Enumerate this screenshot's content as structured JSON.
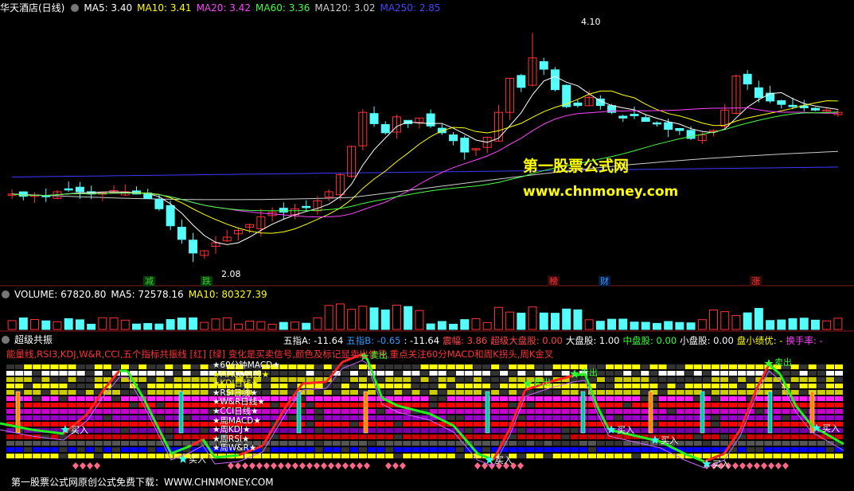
{
  "header": {
    "title": "华天酒店(日线)",
    "ma": [
      {
        "label": "MA5: 3.40",
        "color": "#ffffff"
      },
      {
        "label": "MA10: 3.41",
        "color": "#ffff00"
      },
      {
        "label": "MA20: 3.42",
        "color": "#ff44ff"
      },
      {
        "label": "MA60: 3.36",
        "color": "#44ff44"
      },
      {
        "label": "MA120: 3.02",
        "color": "#cccccc"
      },
      {
        "label": "MA250: 2.85",
        "color": "#4444ff"
      }
    ]
  },
  "price_panel": {
    "high_label": "4.10",
    "low_label": "2.08",
    "calendar_marks": [
      {
        "text": "减",
        "color": "#33cc33"
      },
      {
        "text": "跌",
        "color": "#33cc33"
      },
      {
        "text": "榜",
        "color": "#ff3333"
      },
      {
        "text": "财",
        "color": "#3399ff"
      },
      {
        "text": "涨",
        "color": "#ff3333"
      }
    ],
    "watermark_title": "第一股票公式网",
    "watermark_url": "www.chnmoney.com"
  },
  "volume_panel": {
    "label": "VOLUME: 67820.80",
    "ma5": "MA5: 72578.16",
    "ma10": "MA10: 80327.39"
  },
  "indicator_panel": {
    "name": "超级共振",
    "values": [
      {
        "text": "五指A: -11.64",
        "color": "#ffffff"
      },
      {
        "text": "五指B: -0.65",
        "color": "#3399ff"
      },
      {
        "text": ": -11.64",
        "color": "#ffffff"
      },
      {
        "text": "震幅: 3.86",
        "color": "#ff4444"
      },
      {
        "text": "超级大盘股: 0.00",
        "color": "#ff4444"
      },
      {
        "text": "大盘股: 1.00",
        "color": "#ffffff"
      },
      {
        "text": "中盘股: 0.00",
        "color": "#33ff33"
      },
      {
        "text": "小盘股: 0.00",
        "color": "#ffffff"
      },
      {
        "text": "盘小绩优: -",
        "color": "#ffff00"
      },
      {
        "text": "换手率: -",
        "color": "#ff44ff"
      }
    ],
    "description": "能量线,RSI3,KDJ,W&R,CCI,五个指标共振线 [红] [绿] 变化是买卖信号,颜色及标记显卖出信号,重点关注60分MACD和周K拐头,周K金叉",
    "buy_label": "买入",
    "sell_label": "卖出",
    "legend": [
      "60分钟MACD",
      "MACD日线",
      "KDJ日线",
      "RSI日线",
      "W&R日线",
      "CCI日线",
      "周MACD",
      "周KDJ",
      "周RSI",
      "周W&R"
    ]
  },
  "footer": {
    "text": "第一股票公式网原创公式免费下载：WWW.CHNMONEY.COM"
  },
  "chart_data": {
    "type": "candlestick",
    "symbol": "华天酒店(日线)",
    "price_high": 4.1,
    "price_low": 2.08,
    "moving_averages": {
      "MA5": 3.4,
      "MA10": 3.41,
      "MA20": 3.42,
      "MA60": 3.36,
      "MA120": 3.02,
      "MA250": 2.85
    },
    "close_path": [
      2.68,
      2.66,
      2.67,
      2.66,
      2.7,
      2.72,
      2.7,
      2.68,
      2.69,
      2.71,
      2.7,
      2.68,
      2.64,
      2.55,
      2.4,
      2.28,
      2.16,
      2.18,
      2.25,
      2.3,
      2.36,
      2.41,
      2.48,
      2.52,
      2.52,
      2.55,
      2.56,
      2.62,
      2.7,
      2.85,
      3.1,
      3.4,
      3.3,
      3.22,
      3.36,
      3.3,
      3.35,
      3.28,
      3.22,
      3.15,
      3.05,
      3.08,
      3.18,
      3.4,
      3.7,
      3.62,
      3.88,
      3.78,
      3.6,
      3.45,
      3.46,
      3.53,
      3.46,
      3.4,
      3.35,
      3.37,
      3.32,
      3.3,
      3.25,
      3.24,
      3.17,
      3.2,
      3.24,
      3.42,
      3.72,
      3.65,
      3.53,
      3.5,
      3.47,
      3.45,
      3.44,
      3.42,
      3.42,
      3.4
    ],
    "volume": {
      "value": 67820.8,
      "ma5": 72578.16,
      "ma10": 80327.39
    },
    "indicator": {
      "五指A": -11.64,
      "五指B": -0.65,
      "震幅": 3.86
    }
  }
}
